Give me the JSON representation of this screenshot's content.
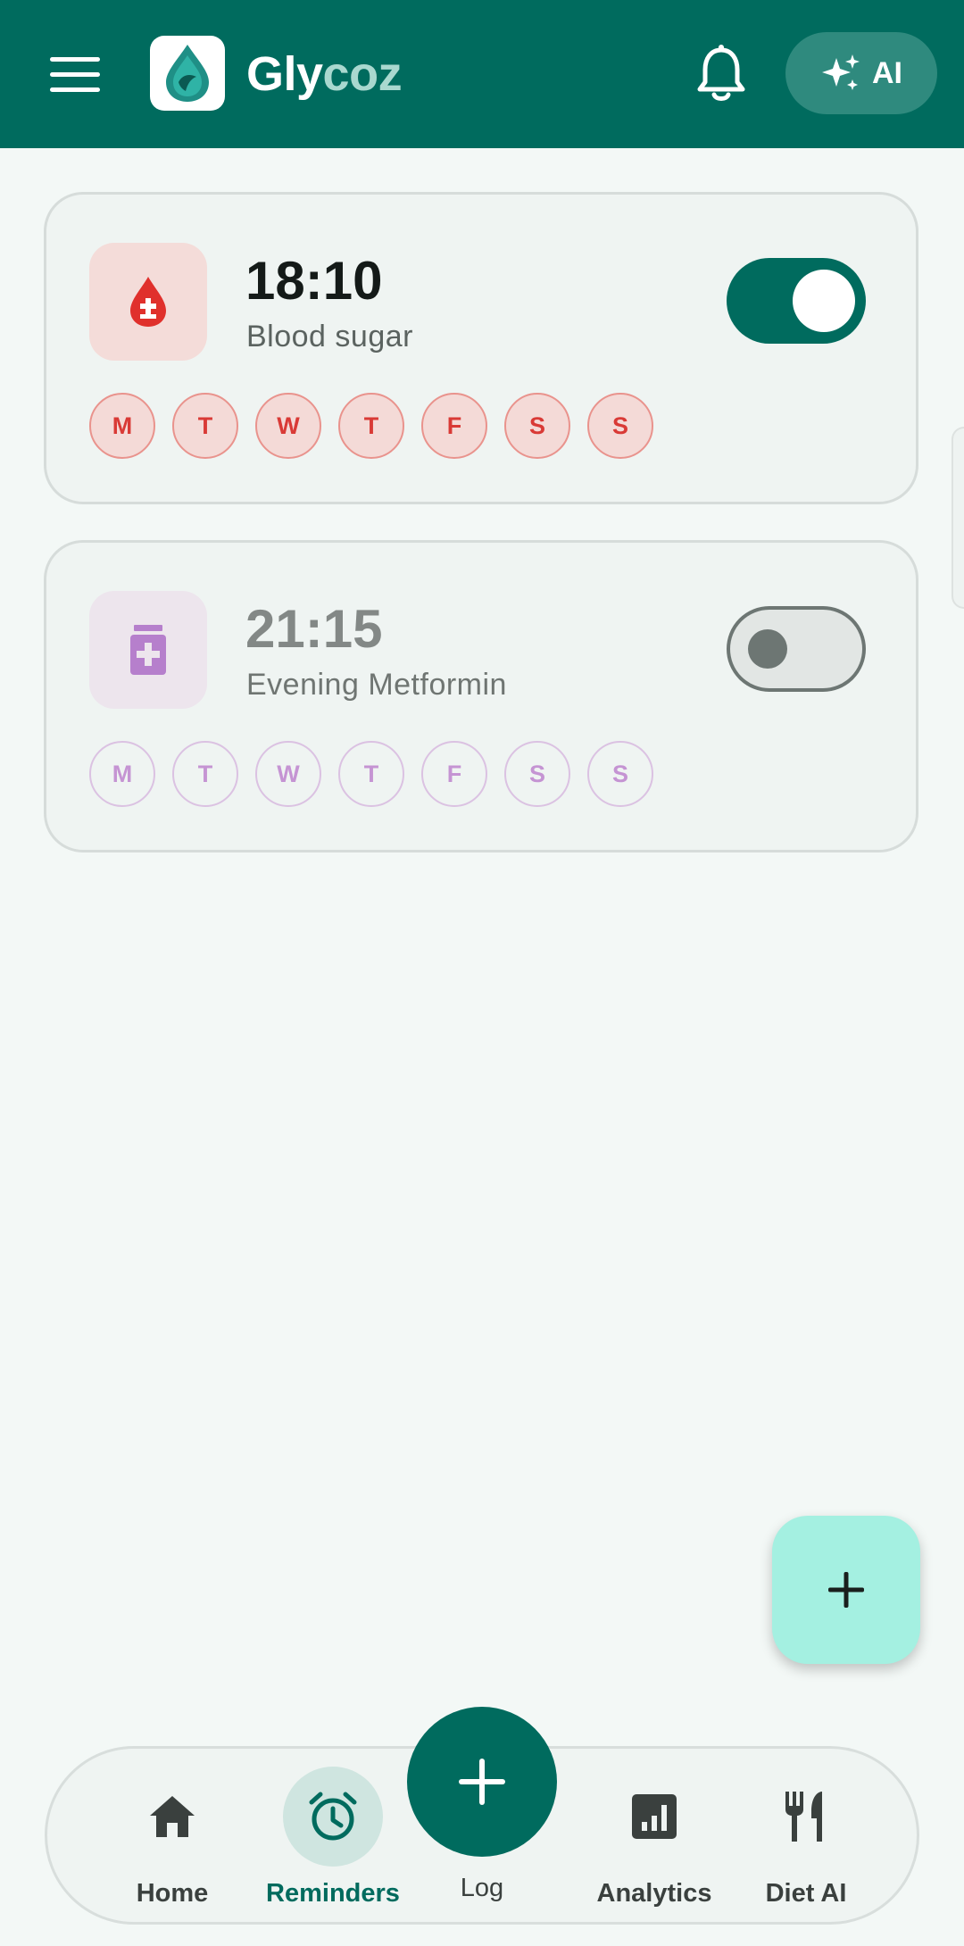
{
  "app": {
    "title_part1": "Gly",
    "title_part2": "coz",
    "ai_label": "AI",
    "primary_color": "#006b5e"
  },
  "reminders": [
    {
      "time": "18:10",
      "label": "Blood sugar",
      "enabled": true,
      "icon": "blood-drop-icon",
      "accent": "#d93a36",
      "days": [
        "M",
        "T",
        "W",
        "T",
        "F",
        "S",
        "S"
      ]
    },
    {
      "time": "21:15",
      "label": "Evening Metformin",
      "enabled": false,
      "icon": "medicine-bottle-icon",
      "accent": "#c594d3",
      "days": [
        "M",
        "T",
        "W",
        "T",
        "F",
        "S",
        "S"
      ]
    }
  ],
  "nav": {
    "home": "Home",
    "reminders": "Reminders",
    "log": "Log",
    "analytics": "Analytics",
    "diet": "Diet AI",
    "active": "reminders"
  }
}
